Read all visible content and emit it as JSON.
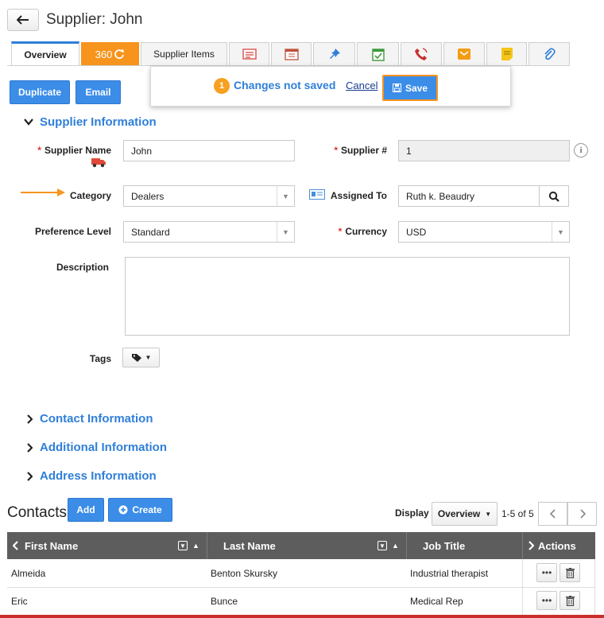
{
  "header": {
    "title": "Supplier: John"
  },
  "tabs": [
    {
      "label": "Overview",
      "active": true
    },
    {
      "label": "360",
      "type": "360"
    },
    {
      "label": "Supplier Items"
    },
    {
      "icon": "newspaper-icon"
    },
    {
      "icon": "calendar-icon"
    },
    {
      "icon": "pin-icon"
    },
    {
      "icon": "task-calendar-icon"
    },
    {
      "icon": "phone-icon"
    },
    {
      "icon": "envelope-icon"
    },
    {
      "icon": "sticky-note-icon"
    },
    {
      "icon": "paperclip-icon"
    }
  ],
  "actions": {
    "duplicate": "Duplicate",
    "email": "Email"
  },
  "unsaved": {
    "count": "1",
    "message": "Changes not saved",
    "cancel": "Cancel",
    "save": "Save"
  },
  "supplier_info": {
    "title": "Supplier Information",
    "supplier_name_label": "Supplier Name",
    "supplier_name": "John",
    "supplier_no_label": "Supplier #",
    "supplier_no": "1",
    "category_label": "Category",
    "category": "Dealers",
    "assigned_to_label": "Assigned To",
    "assigned_to": "Ruth k. Beaudry",
    "preference_label": "Preference Level",
    "preference": "Standard",
    "currency_label": "Currency",
    "currency": "USD",
    "description_label": "Description",
    "description": "",
    "tags_label": "Tags"
  },
  "sections": {
    "contact": "Contact Information",
    "additional": "Additional Information",
    "address": "Address Information"
  },
  "contacts": {
    "title": "Contacts",
    "add": "Add",
    "create": "Create",
    "display_label": "Display",
    "display_value": "Overview",
    "range": "1-5 of 5",
    "columns": [
      "First Name",
      "Last Name",
      "Job Title",
      "Actions"
    ],
    "rows": [
      {
        "first": "Almeida",
        "last": "Benton Skursky",
        "job": "Industrial therapist"
      },
      {
        "first": "Eric",
        "last": "Bunce",
        "job": "Medical Rep"
      }
    ]
  },
  "colors": {
    "accent": "#2f7fd8",
    "orange": "#f7941d",
    "header": "#5d5d5d"
  }
}
